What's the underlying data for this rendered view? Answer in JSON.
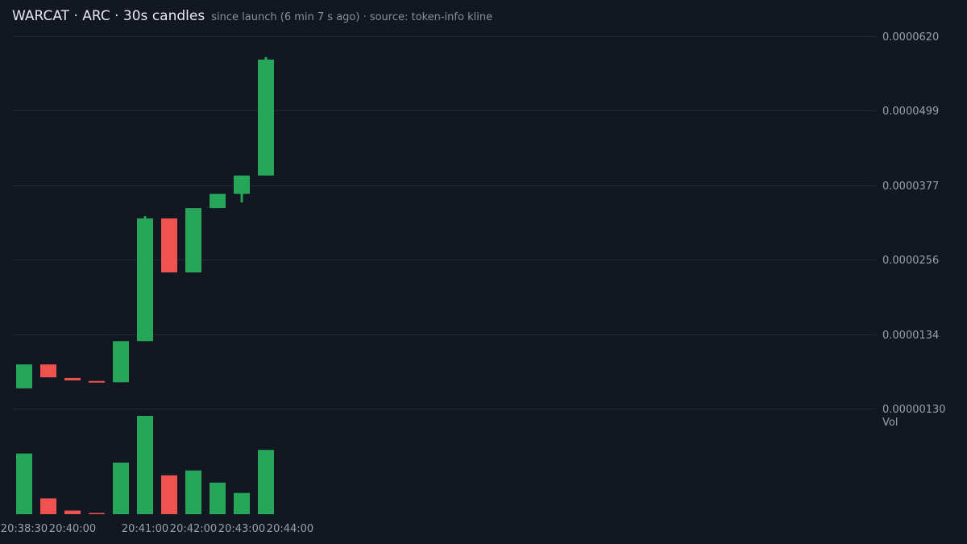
{
  "title": "WARCAT · ARC · 30s candles",
  "subtitle": "since launch (6 min 7 s ago) · source: token-info kline",
  "colors": {
    "background": "#131722",
    "up": "#26a65b",
    "down": "#ef5350",
    "grid": "#242833",
    "text": "#9aa0ab"
  },
  "chart_data": {
    "type": "candlestick",
    "interval": "30s",
    "price_axis_labels": [
      "0.0000620",
      "0.0000499",
      "0.0000377",
      "0.0000256",
      "0.0000134",
      "0.00000130"
    ],
    "price_axis_values": [
      6.2e-05,
      4.99e-05,
      3.77e-05,
      2.56e-05,
      1.34e-05,
      1.3e-06
    ],
    "ylim": [
      1.3e-06,
      6.2e-05
    ],
    "volume_label": "Vol",
    "time_labels": [
      "20:38:30",
      "20:40:00",
      "20:41:00",
      "20:42:00",
      "20:43:00",
      "20:44:00"
    ],
    "time_label_candle_index": [
      0,
      2,
      5,
      7,
      9,
      11
    ],
    "candles": [
      {
        "o": 4.6e-06,
        "h": 8.5e-06,
        "l": 4.6e-06,
        "c": 8.5e-06,
        "v": 100
      },
      {
        "o": 8.5e-06,
        "h": 8.5e-06,
        "l": 6.4e-06,
        "c": 6.4e-06,
        "v": 26
      },
      {
        "o": 6.3e-06,
        "h": 6.3e-06,
        "l": 5.9e-06,
        "c": 5.9e-06,
        "v": 6
      },
      {
        "o": 5.8e-06,
        "h": 5.8e-06,
        "l": 5.6e-06,
        "c": 5.6e-06,
        "v": 2
      },
      {
        "o": 5.6e-06,
        "h": 1.23e-05,
        "l": 5.6e-06,
        "c": 1.23e-05,
        "v": 85
      },
      {
        "o": 1.23e-05,
        "h": 3.27e-05,
        "l": 1.23e-05,
        "c": 3.23e-05,
        "v": 162
      },
      {
        "o": 3.23e-05,
        "h": 3.23e-05,
        "l": 2.35e-05,
        "c": 2.35e-05,
        "v": 64
      },
      {
        "o": 2.35e-05,
        "h": 3.4e-05,
        "l": 2.35e-05,
        "c": 3.4e-05,
        "v": 72
      },
      {
        "o": 3.4e-05,
        "h": 3.63e-05,
        "l": 3.4e-05,
        "c": 3.63e-05,
        "v": 52
      },
      {
        "o": 3.63e-05,
        "h": 3.93e-05,
        "l": 3.49e-05,
        "c": 3.93e-05,
        "v": 35
      },
      {
        "o": 3.93e-05,
        "h": 5.86e-05,
        "l": 3.93e-05,
        "c": 5.82e-05,
        "v": 106
      }
    ]
  }
}
